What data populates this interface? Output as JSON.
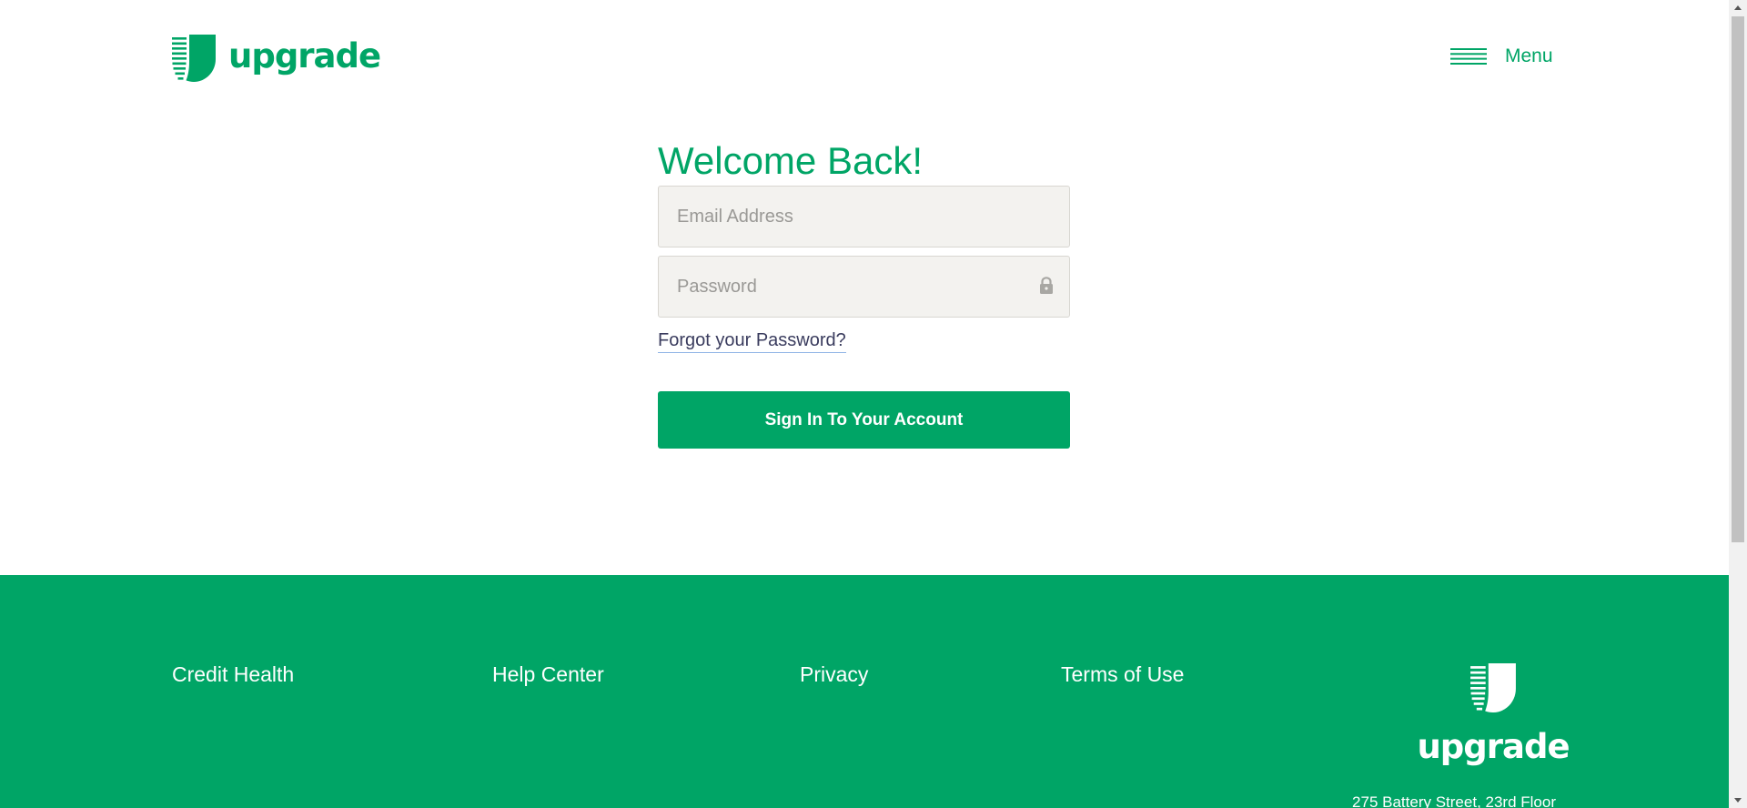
{
  "brand": {
    "name": "upgrade",
    "color": "#00a566"
  },
  "header": {
    "menu_label": "Menu"
  },
  "login": {
    "title": "Welcome Back!",
    "email_placeholder": "Email Address",
    "email_value": "",
    "password_placeholder": "Password",
    "password_value": "",
    "forgot_link": "Forgot your Password?",
    "submit_label": "Sign In To Your Account"
  },
  "footer": {
    "links": [
      {
        "label": "Credit Health"
      },
      {
        "label": "Help Center"
      },
      {
        "label": "Privacy"
      },
      {
        "label": "Terms of Use"
      }
    ],
    "logo_text": "upgrade",
    "address": "275 Battery Street, 23rd Floor"
  },
  "icons": {
    "logo": "upgrade-logo-icon",
    "menu": "hamburger-icon",
    "lock": "lock-icon"
  }
}
